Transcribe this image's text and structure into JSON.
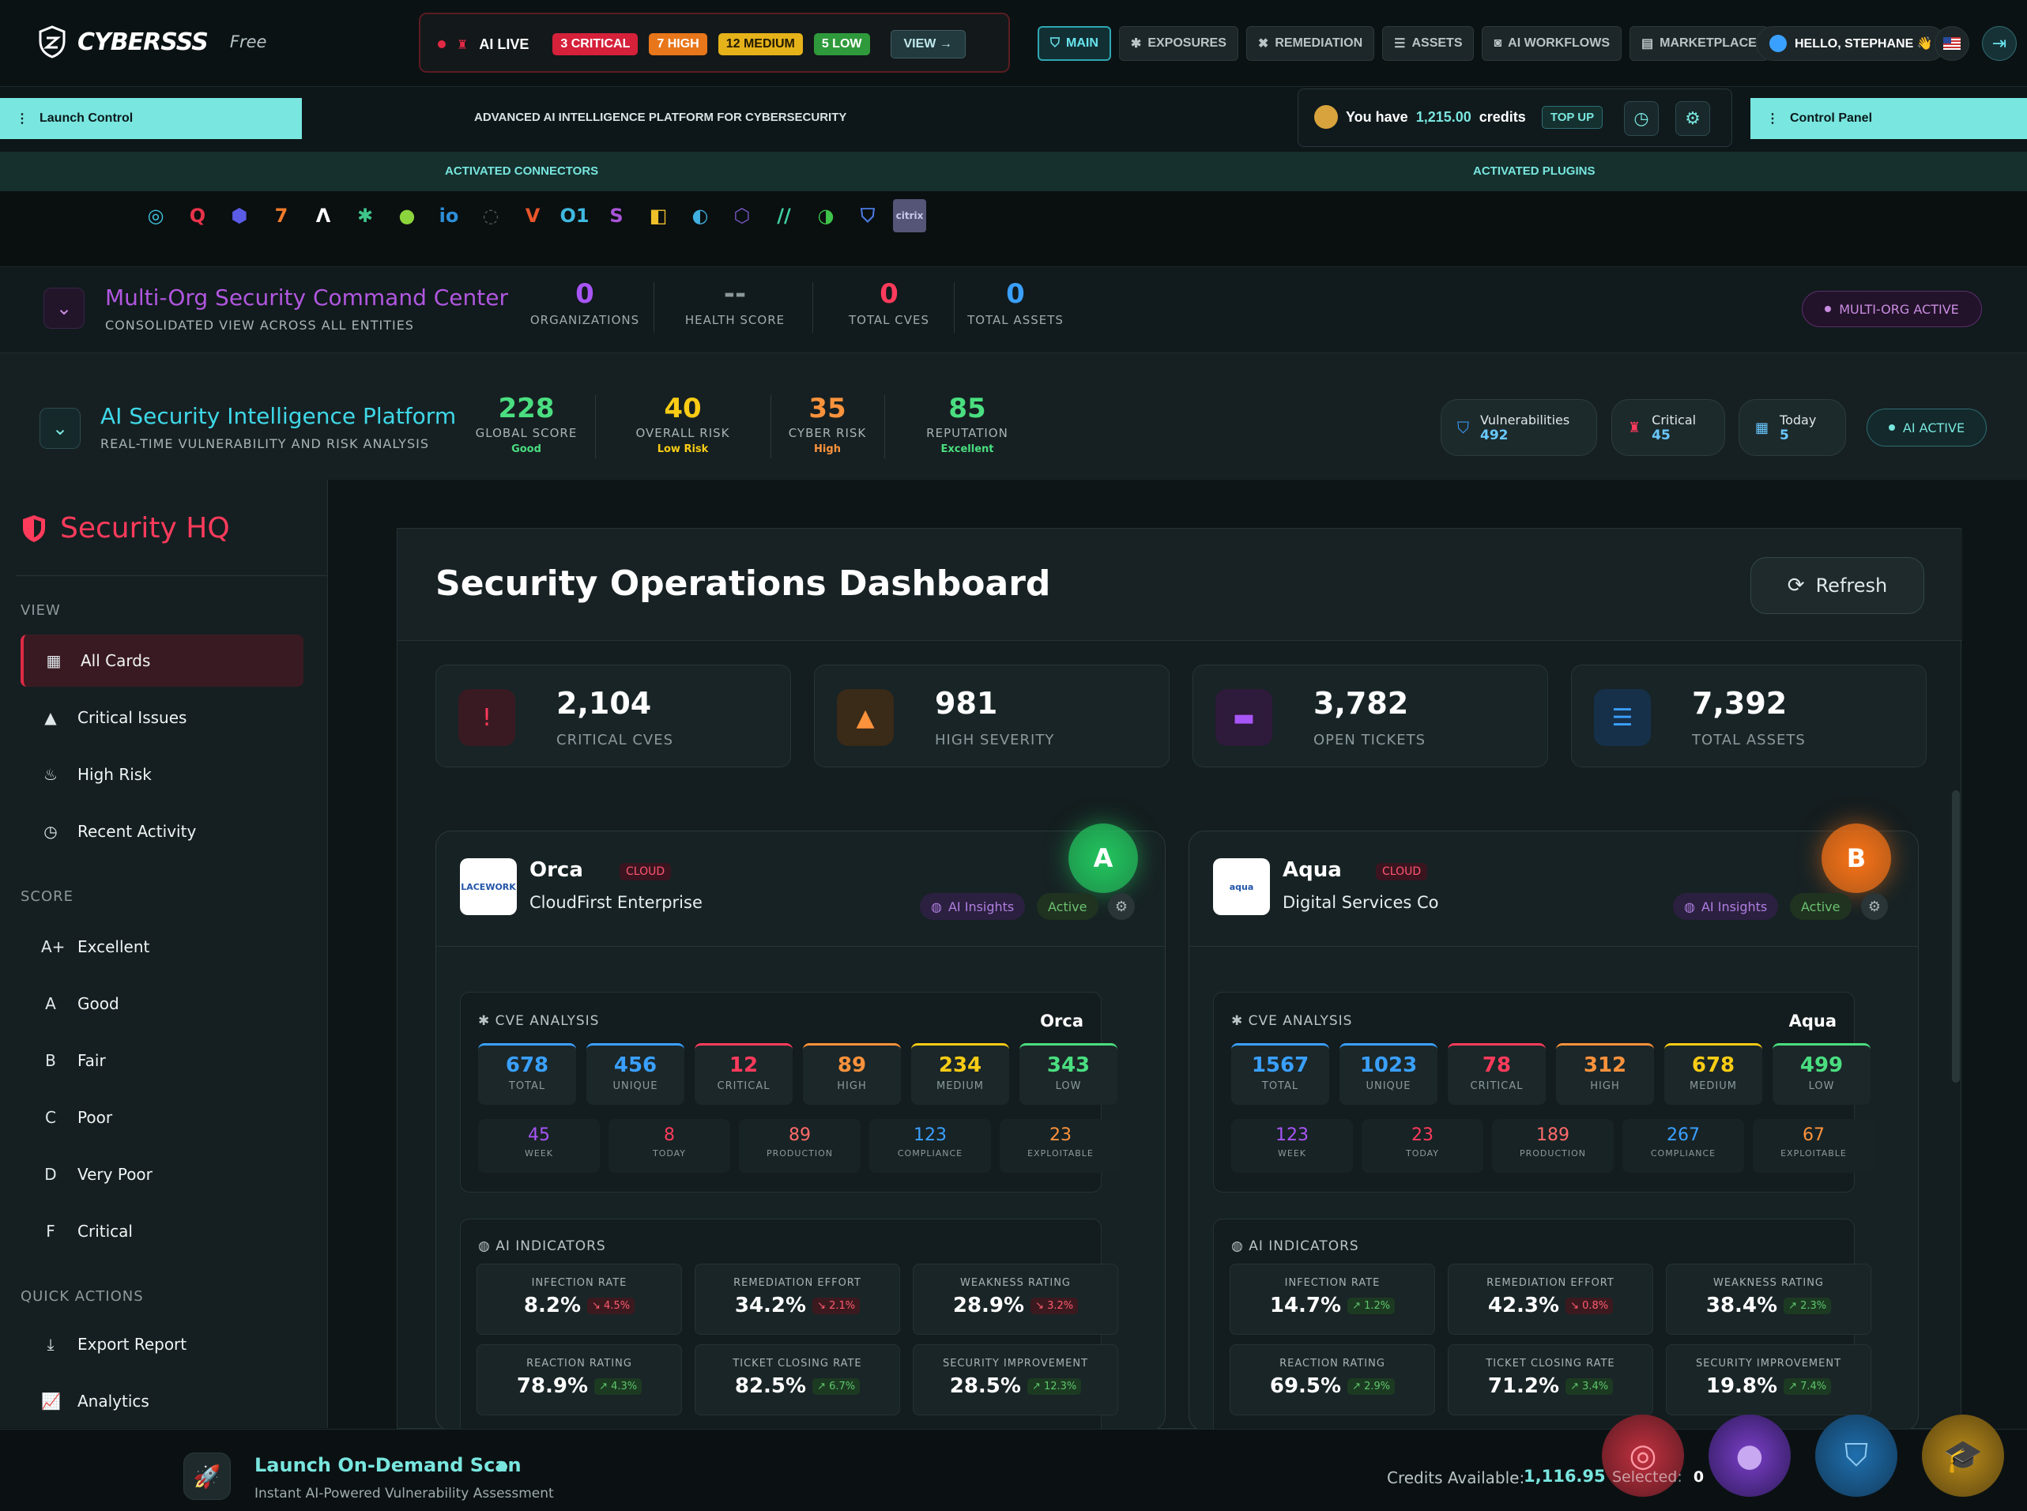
{
  "brand": {
    "name": "CYBERSSS",
    "plan": "Free"
  },
  "alerts": {
    "live_label": "AI LIVE",
    "critical": "3 CRITICAL",
    "high": "7 HIGH",
    "medium": "12 MEDIUM",
    "low": "5 LOW",
    "view_label": "VIEW →"
  },
  "nav": {
    "tabs": [
      {
        "label": "MAIN",
        "icon": "shield-icon"
      },
      {
        "label": "EXPOSURES",
        "icon": "bug-icon"
      },
      {
        "label": "REMEDIATION",
        "icon": "tools-icon"
      },
      {
        "label": "ASSETS",
        "icon": "server-icon"
      },
      {
        "label": "AI WORKFLOWS",
        "icon": "robot-icon"
      },
      {
        "label": "MARKETPLACE",
        "icon": "store-icon"
      }
    ],
    "greeting": "HELLO, STEPHANE 👋"
  },
  "subheader": {
    "launch_control": "Launch Control",
    "tagline": "ADVANCED AI INTELLIGENCE PLATFORM FOR CYBERSECURITY",
    "credits_prefix": "You have",
    "credits_value": "1,215.00",
    "credits_suffix": "credits",
    "top_up": "TOP UP",
    "control_panel": "Control Panel"
  },
  "connectors_bar": {
    "connectors_label": "ACTIVATED CONNECTORS",
    "plugins_label": "ACTIVATED PLUGINS"
  },
  "connectors": [
    {
      "glyph": "◎",
      "color": "#3fc4e0"
    },
    {
      "glyph": "Q",
      "color": "#e8334a"
    },
    {
      "glyph": "⬢",
      "color": "#5b5ce6"
    },
    {
      "glyph": "7",
      "color": "#f07a2a"
    },
    {
      "glyph": "Λ",
      "color": "#ffffff"
    },
    {
      "glyph": "✱",
      "color": "#3fc48a"
    },
    {
      "glyph": "●",
      "color": "#8bd43b"
    },
    {
      "glyph": "io",
      "color": "#2d8ed8"
    },
    {
      "glyph": "◌",
      "color": "#555555"
    },
    {
      "glyph": "V",
      "color": "#e8552a"
    },
    {
      "glyph": "O1",
      "color": "#3fb9e0"
    },
    {
      "glyph": "S",
      "color": "#a855d8"
    },
    {
      "glyph": "◧",
      "color": "#f0c02a"
    },
    {
      "glyph": "◐",
      "color": "#3fb0e0"
    },
    {
      "glyph": "⬡",
      "color": "#7a5ac8"
    },
    {
      "glyph": "//",
      "color": "#3fd0a0"
    },
    {
      "glyph": "◑",
      "color": "#3fc44a"
    },
    {
      "glyph": "⛉",
      "color": "#4a7ae0"
    },
    {
      "glyph": "citrix",
      "color": "#c8c8e8"
    }
  ],
  "multi_org": {
    "title": "Multi-Org Security Command Center",
    "subtitle": "CONSOLIDATED VIEW ACROSS ALL ENTITIES",
    "stats": [
      {
        "value": "0",
        "label": "ORGANIZATIONS",
        "color": "#a855f7"
      },
      {
        "value": "--",
        "label": "HEALTH SCORE",
        "color": "#8c999c"
      },
      {
        "value": "0",
        "label": "TOTAL CVES",
        "color": "#ff3b5c"
      },
      {
        "value": "0",
        "label": "TOTAL ASSETS",
        "color": "#3aa0ff"
      }
    ],
    "active_label": "MULTI-ORG ACTIVE"
  },
  "ai_platform": {
    "title": "AI Security Intelligence Platform",
    "subtitle": "REAL-TIME VULNERABILITY AND RISK ANALYSIS",
    "stats": [
      {
        "value": "228",
        "label": "GLOBAL SCORE",
        "sub": "Good",
        "color": "#4ade80"
      },
      {
        "value": "40",
        "label": "OVERALL RISK",
        "sub": "Low Risk",
        "color": "#facc15"
      },
      {
        "value": "35",
        "label": "CYBER RISK",
        "sub": "High",
        "color": "#fb923c"
      },
      {
        "value": "85",
        "label": "REPUTATION",
        "sub": "Excellent",
        "color": "#4ade80"
      }
    ],
    "pills": [
      {
        "title": "Vulnerabilities",
        "value": "492"
      },
      {
        "title": "Critical",
        "value": "45"
      },
      {
        "title": "Today",
        "value": "5"
      }
    ],
    "active_label": "AI ACTIVE"
  },
  "sidebar": {
    "title": "Security HQ",
    "groups": [
      "VIEW",
      "SCORE",
      "QUICK ACTIONS"
    ],
    "view_items": [
      "All Cards",
      "Critical Issues",
      "High Risk",
      "Recent Activity"
    ],
    "score_items": [
      {
        "grade": "A+",
        "label": "Excellent"
      },
      {
        "grade": "A",
        "label": "Good"
      },
      {
        "grade": "B",
        "label": "Fair"
      },
      {
        "grade": "C",
        "label": "Poor"
      },
      {
        "grade": "D",
        "label": "Very Poor"
      },
      {
        "grade": "F",
        "label": "Critical"
      }
    ],
    "action_items": [
      "Export Report",
      "Analytics"
    ]
  },
  "dashboard": {
    "title": "Security Operations Dashboard",
    "refresh_label": "Refresh",
    "kpis": [
      {
        "value": "2,104",
        "label": "CRITICAL CVES",
        "icon": "alert-circle-icon",
        "color": "#ff3b5c",
        "bg": "#3a1a22"
      },
      {
        "value": "981",
        "label": "HIGH SEVERITY",
        "icon": "warning-triangle-icon",
        "color": "#fb923c",
        "bg": "#3a2a18"
      },
      {
        "value": "3,782",
        "label": "OPEN TICKETS",
        "icon": "ticket-icon",
        "color": "#a855f7",
        "bg": "#2e1a3a"
      },
      {
        "value": "7,392",
        "label": "TOTAL ASSETS",
        "icon": "server-icon",
        "color": "#3aa0ff",
        "bg": "#17304a"
      }
    ]
  },
  "cards": [
    {
      "name": "Orca",
      "tag": "CLOUD",
      "company": "CloudFirst Enterprise",
      "logo_text": "LACEWORK",
      "grade": "A",
      "grade_color": "#22c55e",
      "ai_insights": "AI Insights",
      "status": "Active",
      "cve_heading": "CVE ANALYSIS",
      "org": "Orca",
      "cve": [
        {
          "value": "678",
          "label": "TOTAL",
          "color": "#3aa0ff"
        },
        {
          "value": "456",
          "label": "UNIQUE",
          "color": "#3aa0ff"
        },
        {
          "value": "12",
          "label": "CRITICAL",
          "color": "#ff3b5c"
        },
        {
          "value": "89",
          "label": "HIGH",
          "color": "#fb923c"
        },
        {
          "value": "234",
          "label": "MEDIUM",
          "color": "#facc15"
        },
        {
          "value": "343",
          "label": "LOW",
          "color": "#4ade80"
        }
      ],
      "subs": [
        {
          "value": "45",
          "label": "WEEK",
          "color": "#a855f7"
        },
        {
          "value": "8",
          "label": "TODAY",
          "color": "#ff3b5c"
        },
        {
          "value": "89",
          "label": "PRODUCTION",
          "color": "#ff6b6b"
        },
        {
          "value": "123",
          "label": "COMPLIANCE",
          "color": "#3aa0ff"
        },
        {
          "value": "23",
          "label": "EXPLOITABLE",
          "color": "#fb923c"
        }
      ],
      "ai_heading": "AI INDICATORS",
      "indicators": [
        {
          "label": "INFECTION RATE",
          "value": "8.2%",
          "delta": "↘ 4.5%",
          "dir": "down"
        },
        {
          "label": "REMEDIATION EFFORT",
          "value": "34.2%",
          "delta": "↘ 2.1%",
          "dir": "down"
        },
        {
          "label": "WEAKNESS RATING",
          "value": "28.9%",
          "delta": "↘ 3.2%",
          "dir": "down"
        },
        {
          "label": "REACTION RATING",
          "value": "78.9%",
          "delta": "↗ 4.3%",
          "dir": "up"
        },
        {
          "label": "TICKET CLOSING RATE",
          "value": "82.5%",
          "delta": "↗ 6.7%",
          "dir": "up"
        },
        {
          "label": "SECURITY IMPROVEMENT",
          "value": "28.5%",
          "delta": "↗ 12.3%",
          "dir": "up"
        }
      ]
    },
    {
      "name": "Aqua",
      "tag": "CLOUD",
      "company": "Digital Services Co",
      "logo_text": "aqua",
      "grade": "B",
      "grade_color": "#f97316",
      "ai_insights": "AI Insights",
      "status": "Active",
      "cve_heading": "CVE ANALYSIS",
      "org": "Aqua",
      "cve": [
        {
          "value": "1567",
          "label": "TOTAL",
          "color": "#3aa0ff"
        },
        {
          "value": "1023",
          "label": "UNIQUE",
          "color": "#3aa0ff"
        },
        {
          "value": "78",
          "label": "CRITICAL",
          "color": "#ff3b5c"
        },
        {
          "value": "312",
          "label": "HIGH",
          "color": "#fb923c"
        },
        {
          "value": "678",
          "label": "MEDIUM",
          "color": "#facc15"
        },
        {
          "value": "499",
          "label": "LOW",
          "color": "#4ade80"
        }
      ],
      "subs": [
        {
          "value": "123",
          "label": "WEEK",
          "color": "#a855f7"
        },
        {
          "value": "23",
          "label": "TODAY",
          "color": "#ff3b5c"
        },
        {
          "value": "189",
          "label": "PRODUCTION",
          "color": "#ff6b6b"
        },
        {
          "value": "267",
          "label": "COMPLIANCE",
          "color": "#3aa0ff"
        },
        {
          "value": "67",
          "label": "EXPLOITABLE",
          "color": "#fb923c"
        }
      ],
      "ai_heading": "AI INDICATORS",
      "indicators": [
        {
          "label": "INFECTION RATE",
          "value": "14.7%",
          "delta": "↗ 1.2%",
          "dir": "up"
        },
        {
          "label": "REMEDIATION EFFORT",
          "value": "42.3%",
          "delta": "↘ 0.8%",
          "dir": "down"
        },
        {
          "label": "WEAKNESS RATING",
          "value": "38.4%",
          "delta": "↗ 2.3%",
          "dir": "up"
        },
        {
          "label": "REACTION RATING",
          "value": "69.5%",
          "delta": "↗ 2.9%",
          "dir": "up"
        },
        {
          "label": "TICKET CLOSING RATE",
          "value": "71.2%",
          "delta": "↗ 3.4%",
          "dir": "up"
        },
        {
          "label": "SECURITY IMPROVEMENT",
          "value": "19.8%",
          "delta": "↗ 7.4%",
          "dir": "up"
        }
      ]
    }
  ],
  "bottom": {
    "scan_title": "Launch On-Demand Scan",
    "scan_subtitle": "Instant AI-Powered Vulnerability Assessment",
    "credits_label": "Credits Available:",
    "credits_value": "1,116.95",
    "selected_label": "Selected:",
    "selected_value": "0"
  }
}
